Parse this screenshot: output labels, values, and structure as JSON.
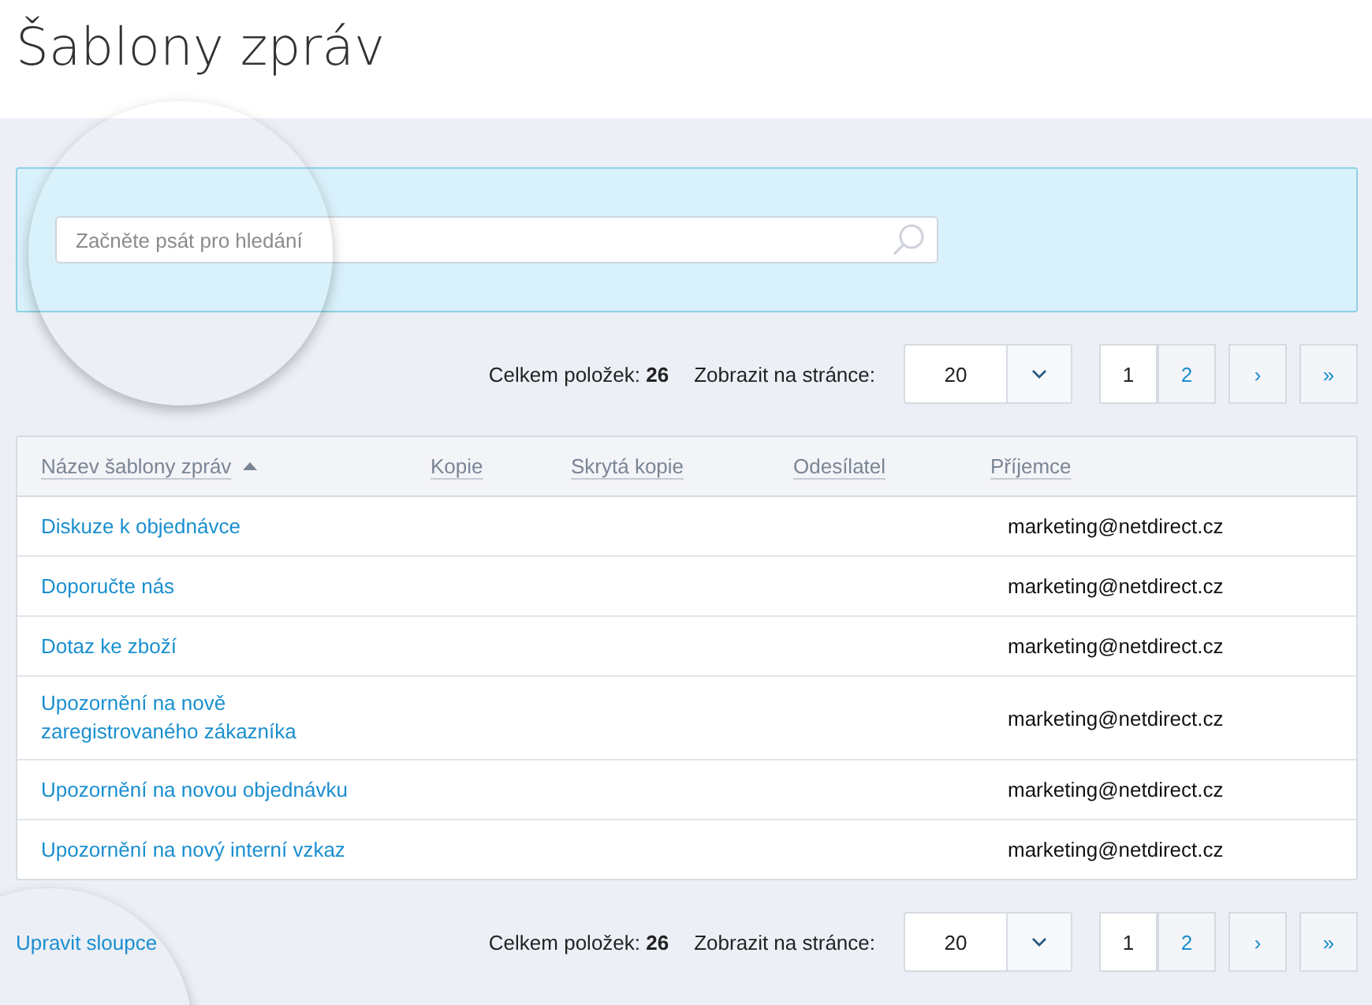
{
  "page": {
    "title": "Šablony zpráv"
  },
  "search": {
    "placeholder": "Začněte psát pro hledání"
  },
  "pagination_top": {
    "total_label": "Celkem položek:",
    "total": "26",
    "per_page_label": "Zobrazit na stránce:",
    "per_page": "20",
    "pages": [
      {
        "label": "1",
        "selected": true
      },
      {
        "label": "2",
        "selected": false
      }
    ],
    "next": "›",
    "last": "»"
  },
  "table": {
    "columns": [
      {
        "label": "Název šablony zpráv",
        "sorted": true
      },
      {
        "label": "Kopie",
        "sorted": false
      },
      {
        "label": "Skrytá kopie",
        "sorted": false
      },
      {
        "label": "Odesílatel",
        "sorted": false
      },
      {
        "label": "Příjemce",
        "sorted": false
      }
    ],
    "rows": [
      {
        "name": "Diskuze k objednávce",
        "recipient": "marketing@netdirect.cz"
      },
      {
        "name": "Doporučte nás",
        "recipient": "marketing@netdirect.cz"
      },
      {
        "name": "Dotaz ke zboží",
        "recipient": "marketing@netdirect.cz"
      },
      {
        "name": "Upozornění na nově zaregistrovaného zákazníka",
        "recipient": "marketing@netdirect.cz"
      },
      {
        "name": "Upozornění na novou objednávku",
        "recipient": "marketing@netdirect.cz"
      },
      {
        "name": "Upozornění na nový interní vzkaz",
        "recipient": "marketing@netdirect.cz"
      }
    ]
  },
  "edit_columns_link": "Upravit sloupce",
  "pagination_bottom": {
    "total_label": "Celkem položek:",
    "total": "26",
    "per_page_label": "Zobrazit na stránce:",
    "per_page": "20",
    "pages": [
      {
        "label": "1",
        "selected": true
      },
      {
        "label": "2",
        "selected": false
      }
    ],
    "next": "›",
    "last": "»"
  }
}
